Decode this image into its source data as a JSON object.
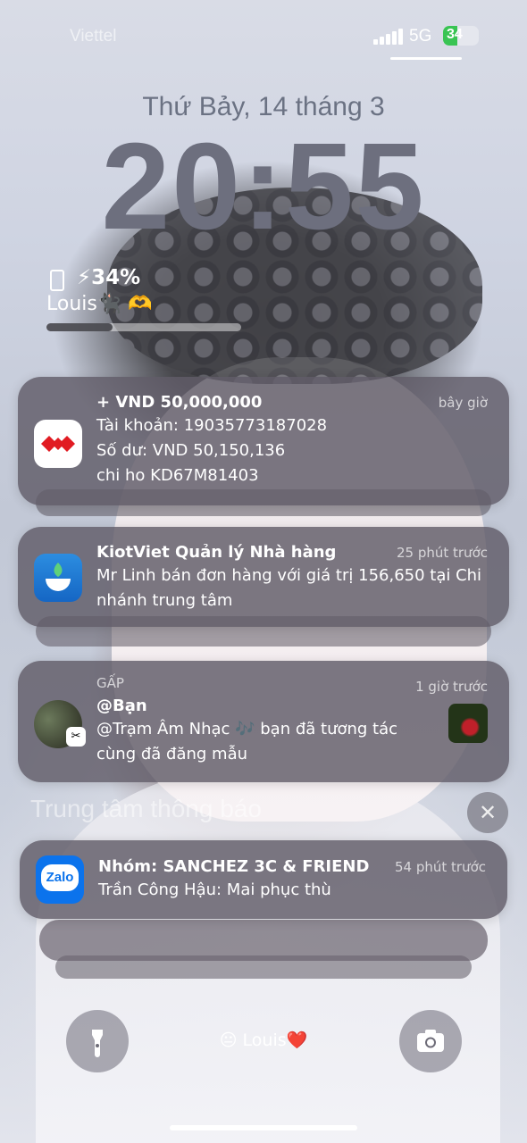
{
  "status_bar": {
    "carrier": "Viettel",
    "network": "5G",
    "battery_level": "34"
  },
  "lock_screen": {
    "date": "Thứ Bảy, 14 tháng 3",
    "time": "20:55"
  },
  "battery_widget": {
    "percent": "34%",
    "owner": "Louis🐈‍⬛ 🫶",
    "bar_fraction": 0.34
  },
  "notifications": [
    {
      "title": "+ VND 50,000,000",
      "time": "bây giờ",
      "lines": [
        "Tài khoản: 19035773187028",
        "Số dư: VND 50,150,136",
        "chi ho KD67M81403"
      ]
    },
    {
      "title": "KiotViet Quản lý Nhà hàng",
      "time": "25 phút trước",
      "lines": [
        "Mr Linh bán đơn hàng với giá trị 156,650 tại Chi",
        "nhánh trung tâm"
      ]
    },
    {
      "tag": "GẤP",
      "title": "@Bạn",
      "time": "1 giờ trước",
      "lines": [
        "@Trạm Âm Nhạc 🎶 bạn đã tương tác",
        "cùng đã đăng mẫu"
      ]
    },
    {
      "title": "Nhóm: SANCHEZ 3C & FRIEND",
      "time": "54 phút trước",
      "lines": [
        "Trần Công Hậu: Mai phục thù"
      ]
    }
  ],
  "notification_center": {
    "label": "Trung tâm thông báo",
    "close_glyph": "✕"
  },
  "bottom": {
    "label": "😐 Louis❤️",
    "zalo_label": "Zalo",
    "capcut_glyph": "✂"
  }
}
